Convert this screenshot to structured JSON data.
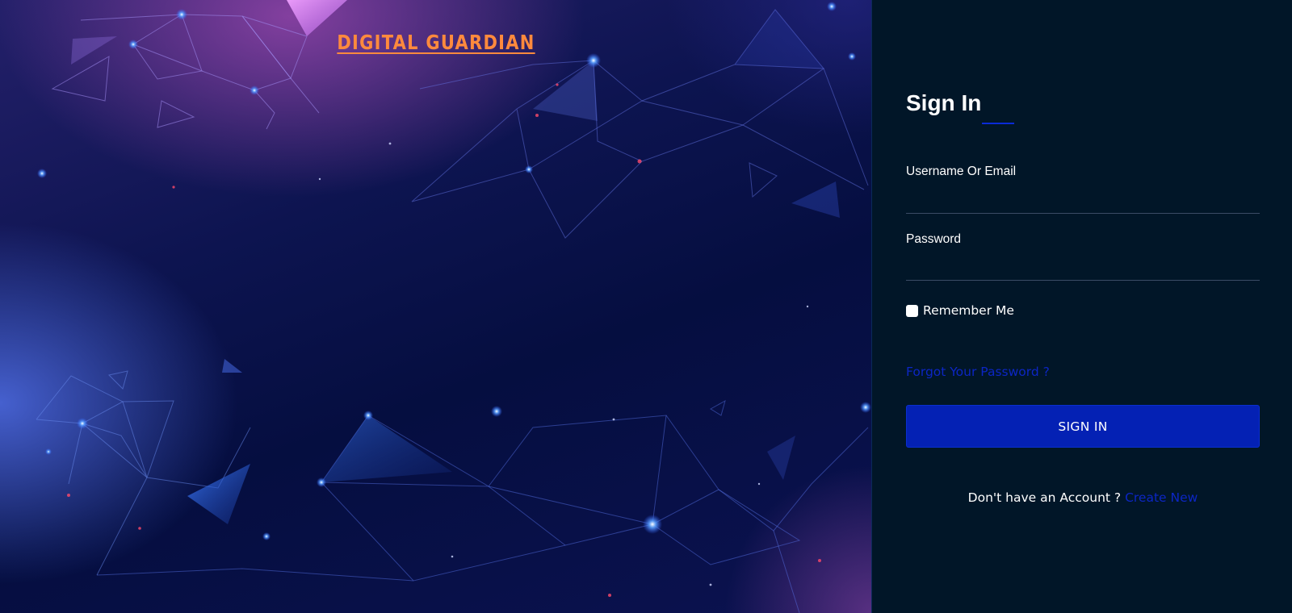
{
  "brand": {
    "logo_text": "DIGITAL GUARDIAN",
    "logo_color": "#ff8a3d"
  },
  "colors": {
    "panel_background": "#011628",
    "accent": "#0421b4",
    "link": "#0c26c4"
  },
  "signin": {
    "title": "Sign In",
    "username_label": "Username Or Email",
    "username_value": "",
    "password_label": "Password",
    "password_value": "",
    "remember_label": "Remember Me",
    "remember_checked": false,
    "forgot_link": "Forgot Your Password ?",
    "button_label": "SIGN IN",
    "no_account_text": "Don't have an Account ?",
    "create_link": "Create New"
  }
}
